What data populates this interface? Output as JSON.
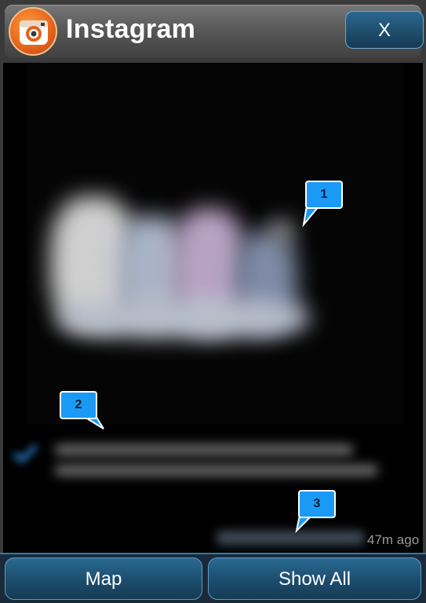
{
  "header": {
    "title": "Instagram",
    "app_icon": "camera-icon",
    "close_label": "X"
  },
  "post": {
    "timestamp": "47m ago"
  },
  "callouts": [
    "1",
    "2",
    "3"
  ],
  "footer": {
    "map_label": "Map",
    "show_all_label": "Show All"
  },
  "colors": {
    "accent": "#1a9af5",
    "button_bg": "#1d4f70",
    "icon_orange": "#e2631b"
  }
}
